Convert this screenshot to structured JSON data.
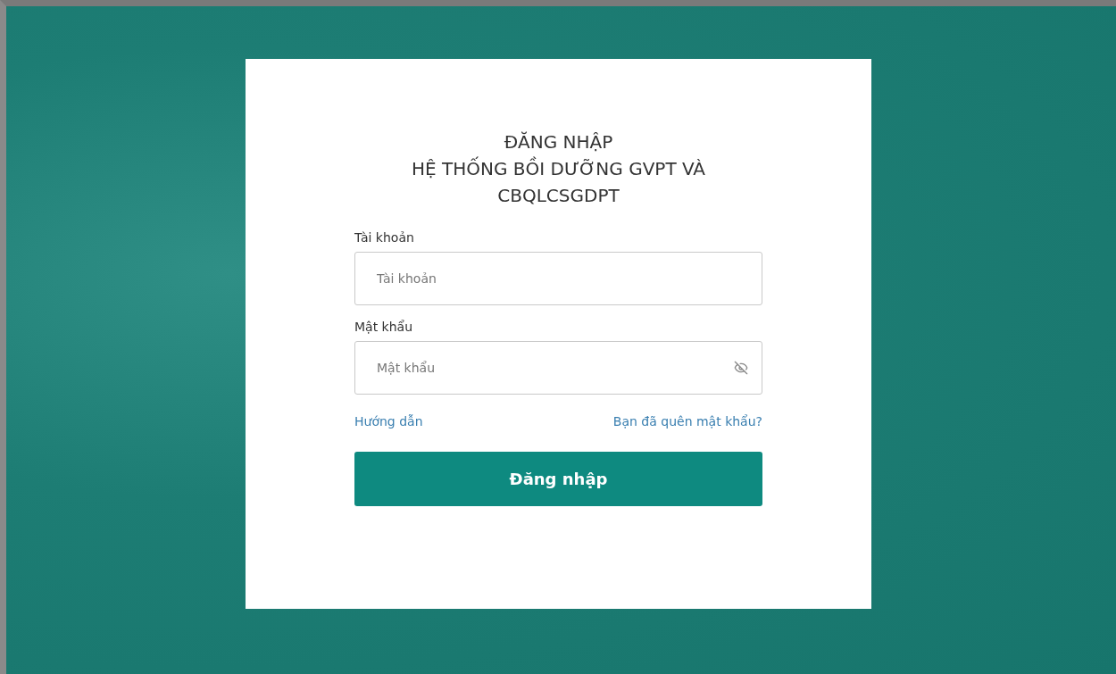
{
  "login": {
    "title_lines": [
      "ĐĂNG NHẬP",
      "HỆ THỐNG BỒI DƯỠNG GVPT VÀ",
      "CBQLCSGDPT"
    ],
    "fields": [
      {
        "kind": "text",
        "label": "Tài khoản",
        "placeholder": "Tài khoản"
      },
      {
        "kind": "password",
        "label": "Mật khẩu",
        "placeholder": "Mật khẩu"
      }
    ],
    "links": [
      "Hướng dẫn",
      "Bạn đã quên mật khẩu?"
    ],
    "submit": "Đăng nhập"
  }
}
